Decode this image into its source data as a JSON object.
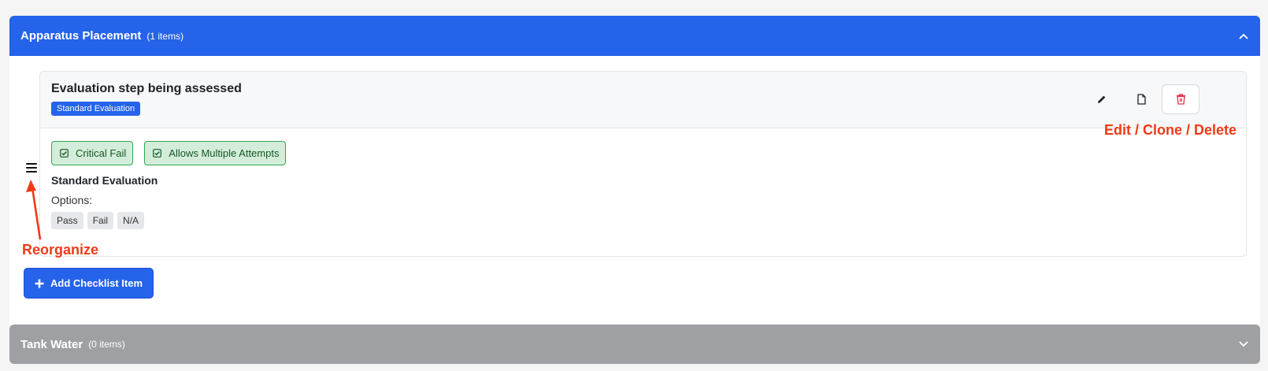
{
  "sections": [
    {
      "title": "Apparatus Placement",
      "count_label": "(1 items)",
      "expanded": true
    },
    {
      "title": "Tank Water",
      "count_label": "(0 items)",
      "expanded": false
    }
  ],
  "item": {
    "title": "Evaluation step being assessed",
    "type_badge": "Standard Evaluation",
    "flags": [
      "Critical Fail",
      "Allows Multiple Attempts"
    ],
    "evaluation_name": "Standard Evaluation",
    "options_label": "Options:",
    "options": [
      "Pass",
      "Fail",
      "N/A"
    ]
  },
  "actions": {
    "edit": "pencil-icon",
    "clone": "document-icon",
    "delete": "trash-icon"
  },
  "add_button_label": "Add Checklist Item",
  "annotations": {
    "reorganize": "Reorganize",
    "actions": "Edit / Clone / Delete"
  },
  "colors": {
    "primary": "#2563eb",
    "collapsed_header": "#9fa0a4",
    "success_bg": "#d4edda",
    "success_border": "#2fa84f",
    "danger": "#dc3545",
    "annotation": "#f03a17"
  }
}
